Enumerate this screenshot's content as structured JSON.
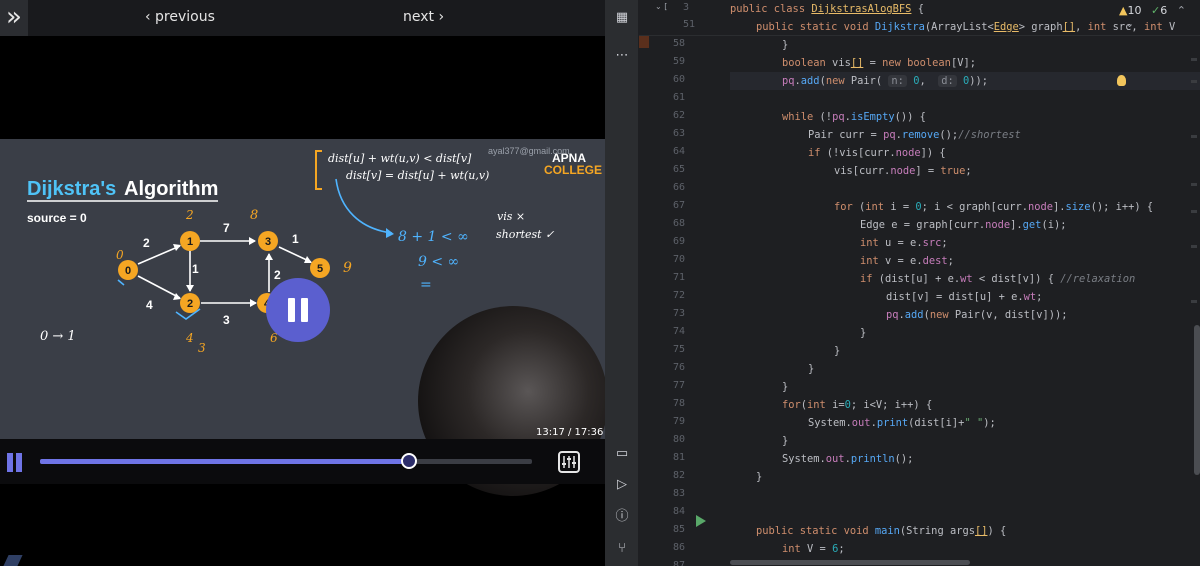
{
  "player": {
    "collapse_icon": "double-chevron-right-icon",
    "prev_label": "‹ previous",
    "next_label": "next ›",
    "timecode": "13:17 / 17:36",
    "progress": 0.75,
    "slide": {
      "title_part1": "Dijkstra's",
      "title_part2": "Algorithm",
      "source": "source = 0",
      "brand_top": "APNA",
      "brand_bottom": "COLLEGE",
      "email": "ayal377@gmail.com",
      "nodes": [
        "0",
        "1",
        "2",
        "3",
        "4",
        "5"
      ],
      "edge_weights": [
        "2",
        "4",
        "7",
        "1",
        "3",
        "1",
        "2"
      ],
      "annotations": {
        "formula1": "dist[u] + wt(u,v) < dist[v]",
        "formula2": "dist[v] = dist[u] + wt(u,v)",
        "calc": "8 + 1 < ∞",
        "result": "9 < ∞",
        "equals": "=",
        "vis": "vis ×",
        "shortest": "shortest ✓",
        "zero_to_one": "0 → 1",
        "n0": "0",
        "n1": "2",
        "n3": "8",
        "n5": "9",
        "n2a": "4",
        "n2b": "3",
        "n4": "6"
      }
    }
  },
  "ide": {
    "warnings": "10",
    "oks": "6",
    "sticky": [
      {
        "ln": "3",
        "text": "public class DijkstrasAlogBFS {"
      },
      {
        "ln": "51",
        "text": "public static void Dijkstra(ArrayList<Edge> graph[], int src, int V"
      }
    ],
    "line_numbers": [
      "58",
      "59",
      "60",
      "61",
      "62",
      "63",
      "64",
      "65",
      "66",
      "67",
      "68",
      "69",
      "70",
      "71",
      "72",
      "73",
      "74",
      "75",
      "76",
      "77",
      "78",
      "79",
      "80",
      "81",
      "82",
      "83",
      "84",
      "85",
      "86",
      "87"
    ]
  },
  "colors": {
    "accent": "#6f74e6",
    "slide_bg": "#3a3e47",
    "node_fill": "#f5a623",
    "ink_blue": "#4fb4ff",
    "ink_orange": "#f5a623"
  }
}
